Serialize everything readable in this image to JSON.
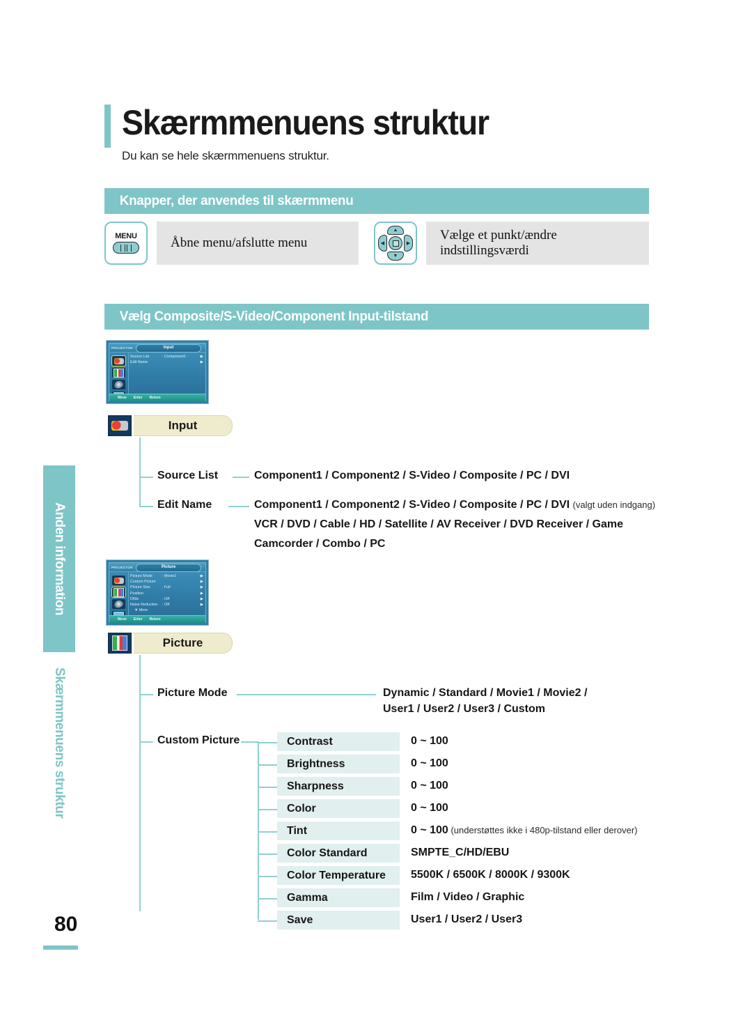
{
  "page": {
    "title": "Skærmmenuens struktur",
    "subtitle": "Du kan se hele skærmmenuens struktur.",
    "number": "80"
  },
  "sidebar": {
    "tab_top": "Anden information",
    "tab_bottom": "Skærmmenuens struktur"
  },
  "sections": {
    "buttons_heading": "Knapper, der anvendes til skærmmenu",
    "input_heading": "Vælg Composite/S-Video/Component Input-tilstand"
  },
  "legend": [
    {
      "icon": "menu-button-icon",
      "key": "MENU",
      "text": "Åbne menu/afslutte menu"
    },
    {
      "icon": "direction-pad-icon",
      "key": "",
      "text": "Vælge et punkt/ændre indstillingsværdi"
    }
  ],
  "osd_input": {
    "brand": "PROJECTOR",
    "title": "Input",
    "rows": [
      {
        "label": "Source List",
        "value": ": Component1",
        "arrow": "▶"
      },
      {
        "label": "Edit Name",
        "value": "",
        "arrow": "▶"
      }
    ],
    "footer": {
      "move": "Move",
      "enter": "Enter",
      "return": "Return"
    }
  },
  "osd_picture": {
    "brand": "PROJECTOR",
    "title": "Picture",
    "rows": [
      {
        "label": "Picture Mode",
        "value": ": Movie1",
        "arrow": "▶"
      },
      {
        "label": "Custom Picture",
        "value": "",
        "arrow": "▶"
      },
      {
        "label": "Picture Size",
        "value": ": Full",
        "arrow": "▶"
      },
      {
        "label": "Position",
        "value": "",
        "arrow": "▶"
      },
      {
        "label": "DNIe",
        "value": ": Off",
        "arrow": "▶"
      },
      {
        "label": "Noise Reduction",
        "value": ": Off",
        "arrow": "▶"
      }
    ],
    "more": "▼ More",
    "footer": {
      "move": "Move",
      "enter": "Enter",
      "return": "Return"
    }
  },
  "input_tree": {
    "category": "Input",
    "category_icon": "av-plug-icon",
    "source_list_label": "Source List",
    "source_list_value": "Component1 / Component2 / S-Video / Composite / PC / DVI",
    "edit_name_label": "Edit Name",
    "edit_name_value_1": "Component1 / Component2 / S-Video / Composite / PC / DVI",
    "edit_name_note": "(valgt uden indgang)",
    "edit_name_value_2": "VCR / DVD / Cable / HD / Satellite / AV Receiver / DVD Receiver / Game",
    "edit_name_value_3": "Camcorder / Combo / PC"
  },
  "picture_tree": {
    "category": "Picture",
    "category_icon": "color-bars-icon",
    "picture_mode_label": "Picture Mode",
    "picture_mode_value_1": "Dynamic / Standard / Movie1 / Movie2 /",
    "picture_mode_value_2": "User1 / User2 / User3 / Custom",
    "custom_picture_label": "Custom Picture",
    "custom_rows": [
      {
        "name": "Contrast",
        "value": "0 ~ 100",
        "note": ""
      },
      {
        "name": "Brightness",
        "value": "0 ~ 100",
        "note": ""
      },
      {
        "name": "Sharpness",
        "value": "0 ~ 100",
        "note": ""
      },
      {
        "name": "Color",
        "value": "0 ~ 100",
        "note": ""
      },
      {
        "name": "Tint",
        "value": "0 ~ 100",
        "note": "(understøttes ikke i 480p-tilstand eller derover)"
      },
      {
        "name": "Color Standard",
        "value": "SMPTE_C/HD/EBU",
        "note": ""
      },
      {
        "name": "Color Temperature",
        "value": "5500K / 6500K / 8000K / 9300K",
        "note": ""
      },
      {
        "name": "Gamma",
        "value": "Film / Video / Graphic",
        "note": ""
      },
      {
        "name": "Save",
        "value": "User1 / User2 / User3",
        "note": ""
      }
    ]
  },
  "colors": {
    "teal": "#7ec5c7",
    "beige": "#eeeccd",
    "chip": "#e1efee",
    "grey": "#e4e4e4"
  }
}
